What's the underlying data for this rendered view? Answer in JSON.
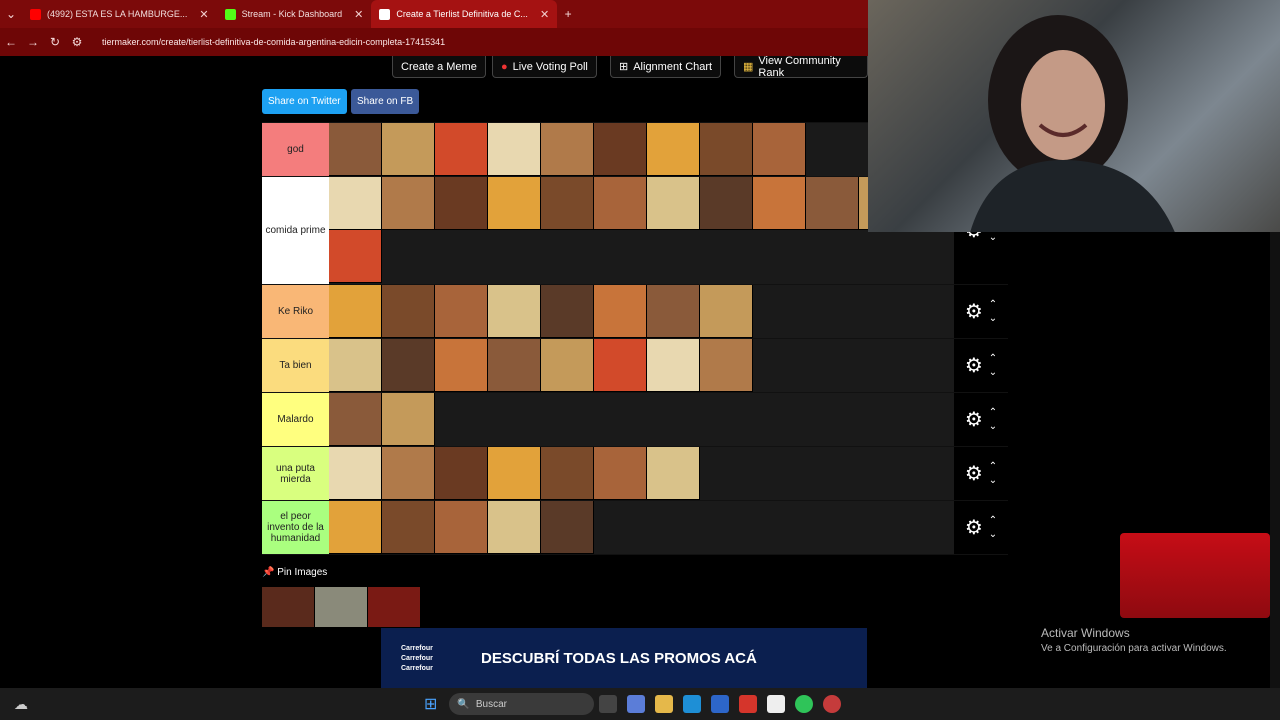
{
  "browser": {
    "tabs": [
      {
        "title": "(4992) ESTA ES LA HAMBURGE...",
        "color": "#ff0000"
      },
      {
        "title": "Stream - Kick Dashboard",
        "color": "#53fc18"
      },
      {
        "title": "Create a Tierlist Definitiva de C...",
        "color": "#ffffff"
      }
    ],
    "url": "tiermaker.com/create/tierlist-definitiva-de-comida-argentina-edicin-completa-17415341"
  },
  "toolbar": {
    "create_meme": "Create a Meme",
    "live_voting": "Live Voting Poll",
    "alignment": "Alignment Chart",
    "community": "View Community Rank"
  },
  "share": {
    "twitter": "Share on Twitter",
    "fb": "Share on FB"
  },
  "tiers": [
    {
      "label": "god",
      "color": "#f47d7d",
      "items": 9,
      "rows": 1
    },
    {
      "label": "comida prime",
      "color": "#ffffff",
      "items": 12,
      "rows": 2
    },
    {
      "label": "Ke Riko",
      "color": "#f9b776",
      "items": 8,
      "rows": 1
    },
    {
      "label": "Ta bien",
      "color": "#fbdc7e",
      "items": 8,
      "rows": 1
    },
    {
      "label": "Malardo",
      "color": "#ffff7f",
      "items": 2,
      "rows": 1
    },
    {
      "label": "una puta mierda",
      "color": "#d9ff7f",
      "items": 7,
      "rows": 1
    },
    {
      "label": "el peor invento de la humanidad",
      "color": "#aaff7f",
      "items": 5,
      "rows": 1
    }
  ],
  "pin": {
    "label": "Pin Images"
  },
  "banner": {
    "brand": "Carrefour",
    "text": "DESCUBRÍ TODAS LAS PROMOS ACÁ"
  },
  "windows": {
    "title": "Activar Windows",
    "subtitle": "Ve a Configuración para activar Windows."
  },
  "taskbar": {
    "search": "Buscar"
  }
}
